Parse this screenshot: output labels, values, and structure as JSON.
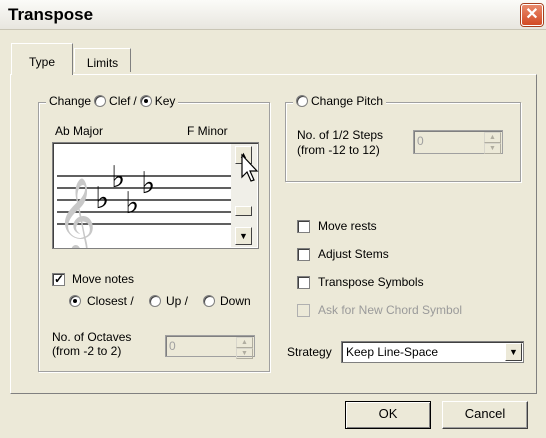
{
  "window": {
    "title": "Transpose",
    "close_glyph": "✕"
  },
  "tabs": [
    {
      "label": "Type"
    },
    {
      "label": "Limits"
    }
  ],
  "change_group": {
    "label": "Change",
    "clef_label": "Clef",
    "separator": "/",
    "key_label": "Key",
    "selected": "Key",
    "from_key": "Ab Major",
    "to_key": "F Minor",
    "staff_clef_glyph": "𝄞",
    "flat_glyph": "♭"
  },
  "move_notes": {
    "label": "Move notes",
    "checked": true,
    "closest_label": "Closest /",
    "up_label": "Up /",
    "down_label": "Down",
    "selected": "Closest"
  },
  "octaves": {
    "label_line1": "No. of Octaves",
    "label_line2": "(from -2 to 2)",
    "value": "0"
  },
  "change_pitch": {
    "label": "Change Pitch",
    "selected": false,
    "steps_line1": "No. of 1/2 Steps",
    "steps_line2": "(from -12 to 12)",
    "value": "0"
  },
  "options": [
    {
      "label": "Move rests",
      "checked": false,
      "enabled": true
    },
    {
      "label": "Adjust Stems",
      "checked": false,
      "enabled": true
    },
    {
      "label": "Transpose Symbols",
      "checked": false,
      "enabled": true
    },
    {
      "label": "Ask for New Chord Symbol",
      "checked": false,
      "enabled": false
    }
  ],
  "strategy": {
    "label": "Strategy",
    "value": "Keep Line-Space"
  },
  "buttons": {
    "ok": "OK",
    "cancel": "Cancel"
  },
  "colors": {
    "dialog_bg": "#ece9d8",
    "close_red": "#d24a24",
    "disabled_text": "#9a9a9a"
  }
}
